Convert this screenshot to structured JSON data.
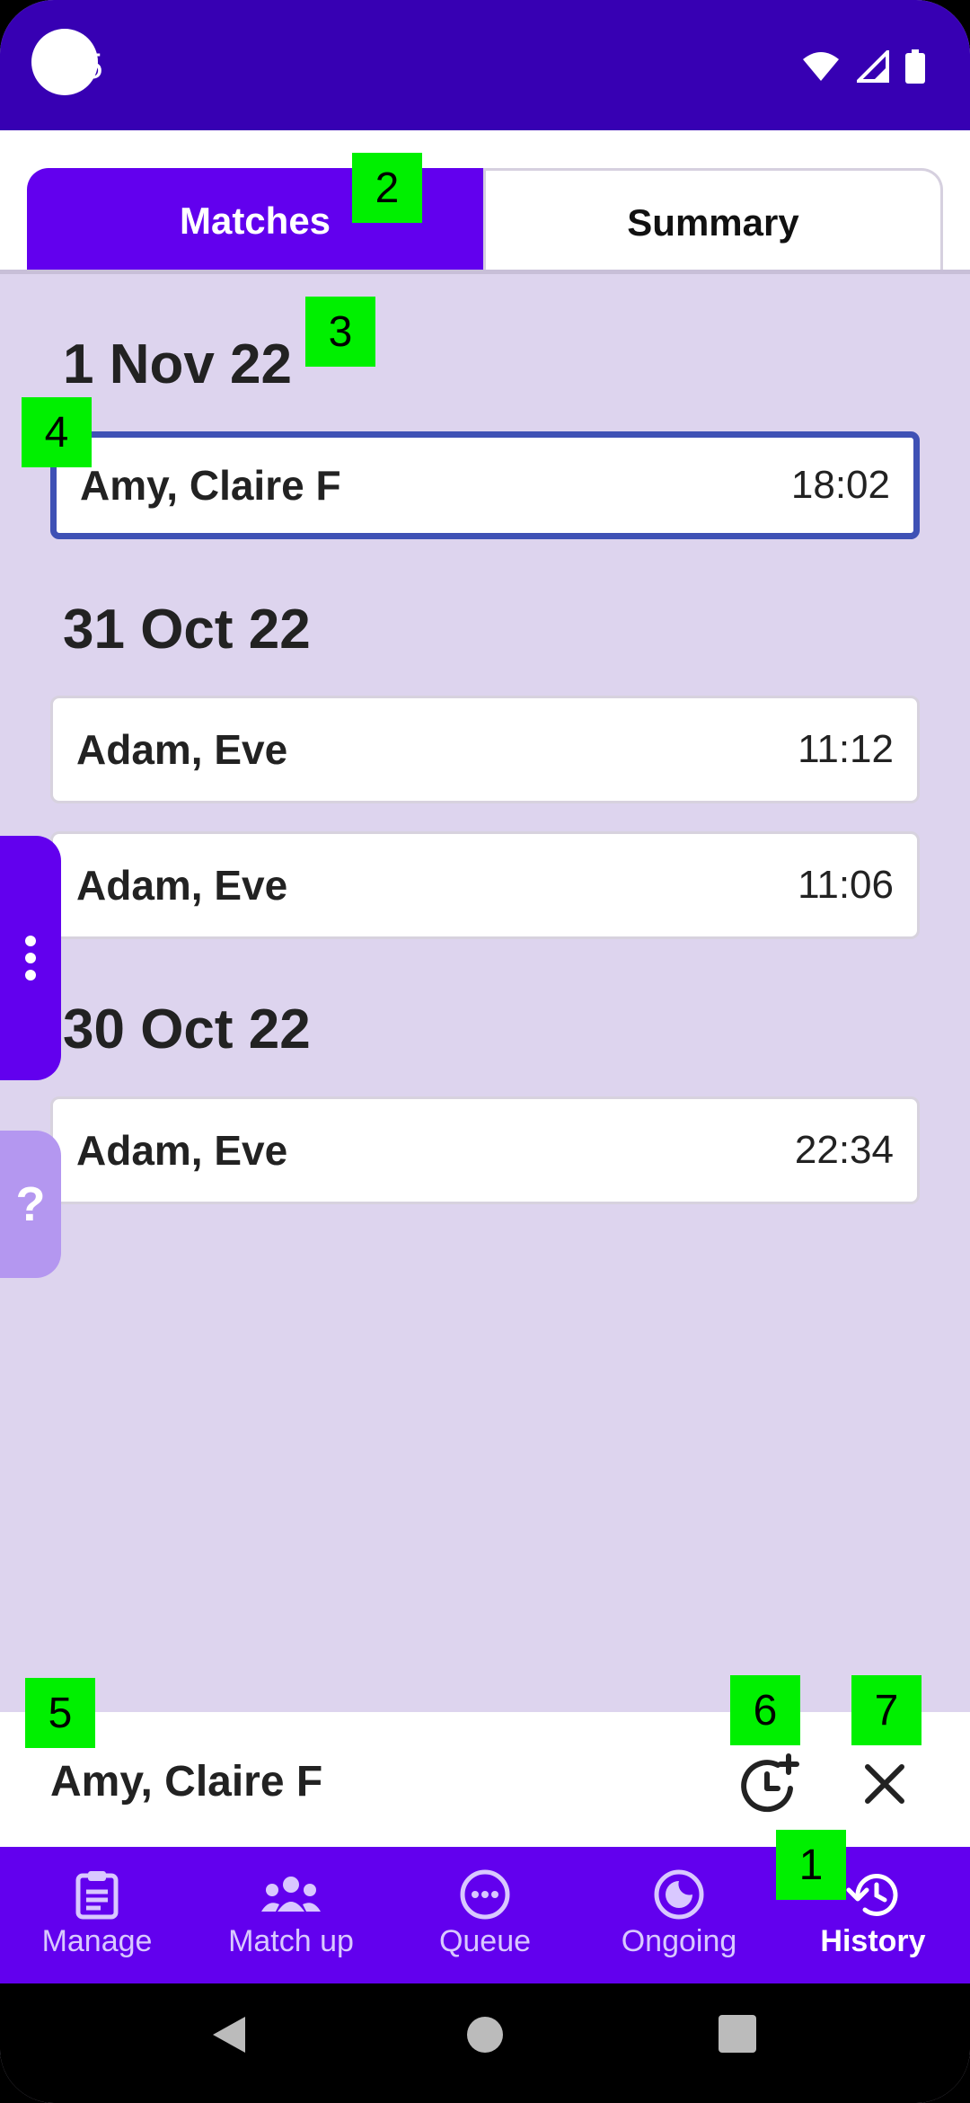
{
  "status_bar": {
    "time": "05"
  },
  "tabs": [
    {
      "label": "Matches"
    },
    {
      "label": "Summary"
    }
  ],
  "history": [
    {
      "date": "1 Nov 22",
      "matches": [
        {
          "names": "Amy, Claire F",
          "time": "18:02"
        }
      ]
    },
    {
      "date": "31 Oct 22",
      "matches": [
        {
          "names": "Adam, Eve",
          "time": "11:12"
        },
        {
          "names": "Adam, Eve",
          "time": "11:06"
        }
      ]
    },
    {
      "date": "30 Oct 22",
      "matches": [
        {
          "names": "Adam, Eve",
          "time": "22:34"
        }
      ]
    }
  ],
  "side": {
    "help_label": "?"
  },
  "selection": {
    "name": "Amy, Claire F"
  },
  "bottom_nav": [
    {
      "label": "Manage",
      "icon": "clipboard-icon"
    },
    {
      "label": "Match up",
      "icon": "group-icon"
    },
    {
      "label": "Queue",
      "icon": "more-horizontal-circle-icon"
    },
    {
      "label": "Ongoing",
      "icon": "moon-circle-icon"
    },
    {
      "label": "History",
      "icon": "history-icon",
      "active": true
    }
  ],
  "markers": [
    "1",
    "2",
    "3",
    "4",
    "5",
    "6",
    "7"
  ],
  "colors": {
    "primary": "#6200ee",
    "primary_dark": "#3700b3",
    "background": "#ddd4ee",
    "selected_border": "#3f51b5",
    "marker": "#00f000"
  }
}
